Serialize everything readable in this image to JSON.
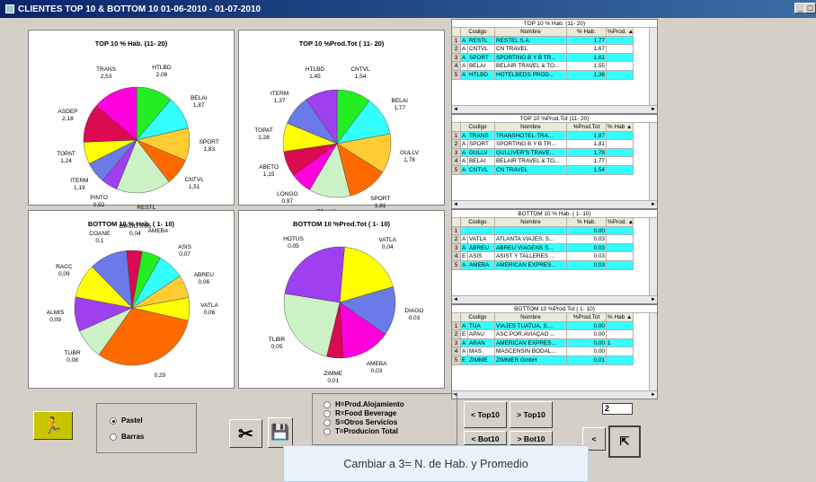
{
  "window": {
    "title": "CLIENTES TOP 10 & BOTTOM 10  01-06-2010 - 01-07-2010",
    "min_label": "_",
    "restore_label": "□"
  },
  "colors": [
    "#ff6a00",
    "#ccf2c6",
    "#9f40f0",
    "#ff00dd",
    "#dc0a50",
    "#6a7ae6",
    "#ffff00",
    "#22ee22",
    "#33ffff",
    "#ffcc33",
    "#b07ad0"
  ],
  "charts": [
    {
      "title": "TOP 10  % Hab.    (11- 20)",
      "chart_data": {
        "type": "pie",
        "labels": [
          "HTLBD",
          "BELAI",
          "SPORT",
          "CNTVL",
          "RESTL",
          "PINTO",
          "ITERM",
          "TOPAT",
          "ASDEP",
          "TRANS"
        ],
        "values": [
          2.06,
          1.87,
          1.83,
          1.51,
          3.05,
          0.92,
          1.19,
          1.24,
          2.18,
          2.53
        ]
      },
      "labels": [
        [
          "HTLBD",
          "2,06"
        ],
        [
          "BELAI",
          "1,87"
        ],
        [
          "SPORT",
          "1,83"
        ],
        [
          "CNTVL",
          "1,51"
        ],
        [
          "RESTL",
          "3,05"
        ],
        [
          "PINTO",
          "0,92"
        ],
        [
          "ITERM",
          "1,19"
        ],
        [
          "TOPAT",
          "1,24"
        ],
        [
          "ASDEP",
          "2,18"
        ],
        [
          "TRANS",
          "2,53"
        ]
      ]
    },
    {
      "title": "TOP 10  %Prod.Tot  ( 11- 20)",
      "chart_data": {
        "type": "pie",
        "labels": [
          "CNTVL",
          "BELAI",
          "GULLV",
          "SPORT",
          "TRANS",
          "LONGO",
          "ABETO",
          "TOPAT",
          "ITERM",
          "HTLBD"
        ],
        "values": [
          1.54,
          1.77,
          1.78,
          1.81,
          1.87,
          0.97,
          1.15,
          1.28,
          1.37,
          1.45
        ]
      },
      "labels": [
        [
          "CNTVL",
          "1,54"
        ],
        [
          "BELAI",
          "1,77"
        ],
        [
          "GULLV",
          "1,78"
        ],
        [
          "SPORT",
          "1,81"
        ],
        [
          "TRANS",
          "1,87"
        ],
        [
          "LONGO",
          "0,97"
        ],
        [
          "ABETO",
          "1,15"
        ],
        [
          "TOPAT",
          "1,28"
        ],
        [
          "ITERM",
          "1,37"
        ],
        [
          "HTLBD",
          "1,45"
        ]
      ]
    },
    {
      "title": "BOTTOM 10  % Hab.    ( 1- 10)",
      "chart_data": {
        "type": "pie",
        "labels": [
          "AMEBA",
          "ASIS",
          "ABREU",
          "VATLA",
          "(sin etiqueta)",
          "TLIBR",
          "ALMIS",
          "RACC",
          "COANE",
          "DIAGO"
        ],
        "values": [
          0.05,
          0.07,
          0.06,
          0.06,
          0.29,
          0.08,
          0.09,
          0.09,
          0.1,
          0.04
        ]
      },
      "labels": [
        [
          "AMEBA",
          ""
        ],
        [
          "ASIS",
          "0,07"
        ],
        [
          "ABREU",
          "0,06"
        ],
        [
          "VATLA",
          "0,06"
        ],
        [
          "",
          "0,29"
        ],
        [
          "TLIBR",
          "0,08"
        ],
        [
          "ALMIS",
          "0,09"
        ],
        [
          "RACC",
          "0,09"
        ],
        [
          "COANE",
          "0,1"
        ],
        [
          "DIAGO 0,05",
          "0,04"
        ]
      ]
    },
    {
      "title": "BOTTOM 10  %Prod.Tot  ( 1- 10)",
      "chart_data": {
        "type": "pie",
        "labels": [
          "VATLA",
          "DIAGO",
          "AMEBA",
          "ZIMME",
          "TLIBR",
          "HOTUS"
        ],
        "values": [
          0.04,
          0.03,
          0.03,
          0.01,
          0.05,
          0.05
        ]
      },
      "labels": [
        [
          "VATLA",
          "0,04"
        ],
        [
          "DIAGO",
          "0,03"
        ],
        [
          "AMEBA",
          "0,03"
        ],
        [
          "ZIMME",
          "0,01"
        ],
        [
          "TLIBR",
          "0,05"
        ],
        [
          "HOTUS",
          "0,05"
        ]
      ]
    }
  ],
  "grids": [
    {
      "title": "TOP 10  % Hab.    (11- 20)",
      "cols": [
        "",
        "Codigo",
        "Nombre",
        "% Hab.",
        "%Prod. ▲"
      ],
      "rows": [
        [
          "1",
          "A",
          "RESTL",
          "RESTEL S.A.",
          "1,77",
          "",
          true
        ],
        [
          "2",
          "A",
          "CNTVL",
          "CN TRAVEL",
          "1,67",
          "",
          false
        ],
        [
          "3",
          "A",
          "SPORT",
          "SPORTING B Y B TR...",
          "1,61",
          "",
          true
        ],
        [
          "4",
          "A",
          "BELAI",
          "BELAIR TRAVEL & TO...",
          "1,55",
          "",
          false
        ],
        [
          "5",
          "A",
          "HTLBD",
          "HOTELBEDS PROD...",
          "1,36",
          "",
          true
        ]
      ]
    },
    {
      "title": "TOP 10  %Prod.Tot  (11- 20)",
      "cols": [
        "",
        "Codigo",
        "Nombre",
        "%Prod.Tot",
        "% Hab ▲"
      ],
      "rows": [
        [
          "1",
          "A",
          "TRANS",
          "TRANSHOTEL-TRA...",
          "1,87",
          "",
          true
        ],
        [
          "2",
          "A",
          "SPORT",
          "SPORTING B Y B TR...",
          "1,81",
          "",
          false
        ],
        [
          "3",
          "A",
          "GULLV",
          "GULLIVER'S TRAVE...",
          "1,78",
          "",
          true
        ],
        [
          "4",
          "A",
          "BELAI",
          "BELAIR TRAVEL & TO...",
          "1,77",
          "",
          false
        ],
        [
          "5",
          "A",
          "CNTVL",
          "CN TRAVEL",
          "1,54",
          "",
          true
        ]
      ]
    },
    {
      "title": "BOTTOM 10  % Hab.    ( 1- 10)",
      "cols": [
        "",
        "Codigo",
        "Nombre",
        "% Hab.",
        "%Prod. ▲"
      ],
      "rows": [
        [
          "1",
          "",
          "",
          "",
          "0,00",
          "",
          true
        ],
        [
          "2",
          "A",
          "VATLA",
          "ATLANTA VIAJES, S...",
          "0,03",
          "",
          false
        ],
        [
          "3",
          "A",
          "ABREU",
          "ABREU VIAGENS S...",
          "0,03",
          "",
          true
        ],
        [
          "4",
          "E",
          "ASIS",
          "ASIST Y TALLERES ...",
          "0,03",
          "",
          false
        ],
        [
          "5",
          "A",
          "AMEBA",
          "AMERICAN EXPRES...",
          "0,03",
          "",
          true
        ]
      ]
    },
    {
      "title": "BOTTOM 10  %Prod.Tot  ( 1- 10)",
      "cols": [
        "",
        "Codigo",
        "Nombre",
        "%Prod.Tot",
        "% Hab ▲"
      ],
      "rows": [
        [
          "1",
          "A",
          "TUA",
          "VIAJES TUATUA, S....",
          "0,00",
          "",
          true
        ],
        [
          "2",
          "E",
          "APAU",
          "ASC.POR.AVIAÇAO ...",
          "0,00",
          "",
          false
        ],
        [
          "3",
          "A",
          "ARAN",
          "AMERICAN EXPRES...",
          "0,00",
          "1",
          true
        ],
        [
          "4",
          "A",
          "MAS",
          "MASCENSIN BODAL...",
          "0,00",
          "",
          false
        ],
        [
          "5",
          "E",
          "ZIMME",
          "ZIMMER GmbH",
          "0,01",
          "",
          true
        ]
      ]
    }
  ],
  "options": {
    "pastel": "Pastel",
    "barras": "Barras"
  },
  "modes": [
    "H=Prod.Alojamiento",
    "R=Food  Beverage",
    "S=Otros Servicios",
    "T=Producion Total"
  ],
  "nav": {
    "prev_top": "< Top10",
    "next_top": "> Top10",
    "prev_bot": "< Bot10",
    "next_bot": "> Bot10",
    "prev": "<",
    "page_value": "2"
  },
  "tooltip": "Cambiar a 3= N. de Hab. y Promedio"
}
